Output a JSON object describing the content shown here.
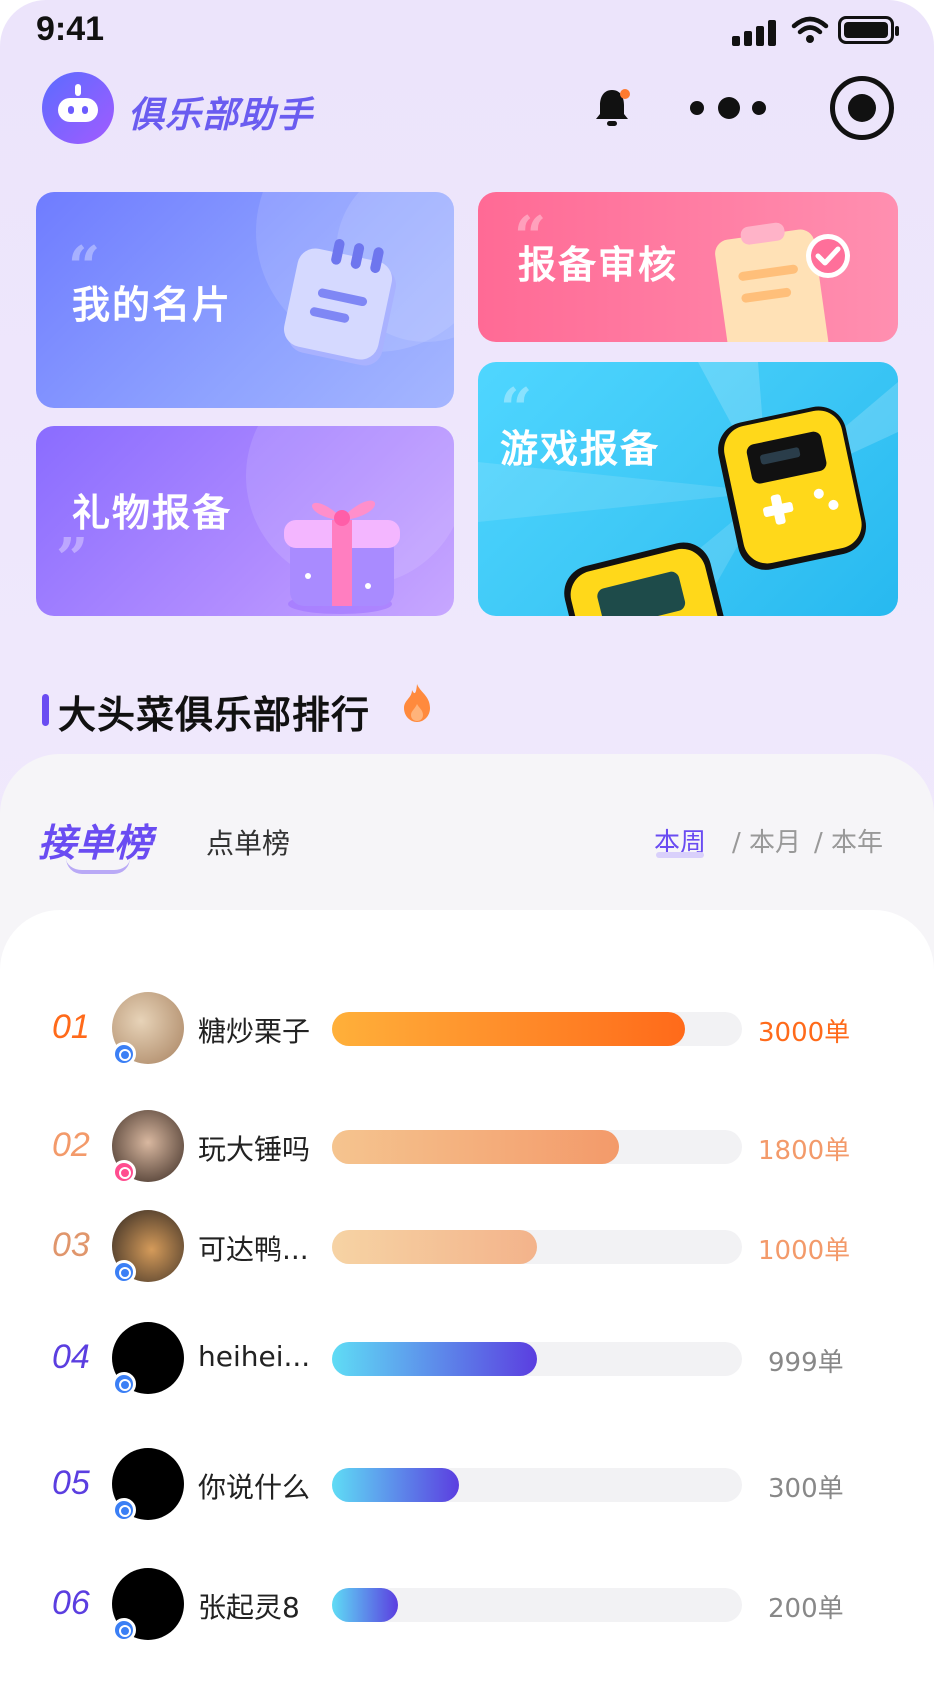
{
  "status": {
    "time": "9:41"
  },
  "header": {
    "title": "俱乐部助手"
  },
  "cards": {
    "my_card": "我的名片",
    "gift_report": "礼物报备",
    "report_review": "报备审核",
    "game_report": "游戏报备"
  },
  "section": {
    "title": "大头菜俱乐部排行"
  },
  "tabs": {
    "active": "接单榜",
    "other": "点单榜"
  },
  "periods": {
    "week": "本周",
    "month": "/ 本月",
    "year": "/ 本年",
    "sep": "/"
  },
  "colors": {
    "accent": "#6a4cf2",
    "rank1": "#ff6a1a",
    "rank2": "#f39a6a",
    "rank3": "#e0966c",
    "rank_other": "#5b3ee0",
    "count_other": "#888888"
  },
  "ranking": [
    {
      "rank": "01",
      "name": "糖炒栗子",
      "count": "3000单",
      "progress": 0.86,
      "gender": "male"
    },
    {
      "rank": "02",
      "name": "玩大锤吗",
      "count": "1800单",
      "progress": 0.7,
      "gender": "female"
    },
    {
      "rank": "03",
      "name": "可达鸭...",
      "count": "1000单",
      "progress": 0.5,
      "gender": "male"
    },
    {
      "rank": "04",
      "name": "heihei...",
      "count": "999单",
      "progress": 0.5,
      "gender": "male"
    },
    {
      "rank": "05",
      "name": "你说什么",
      "count": "300单",
      "progress": 0.31,
      "gender": "male"
    },
    {
      "rank": "06",
      "name": "张起灵8",
      "count": "200单",
      "progress": 0.16,
      "gender": "male"
    }
  ]
}
